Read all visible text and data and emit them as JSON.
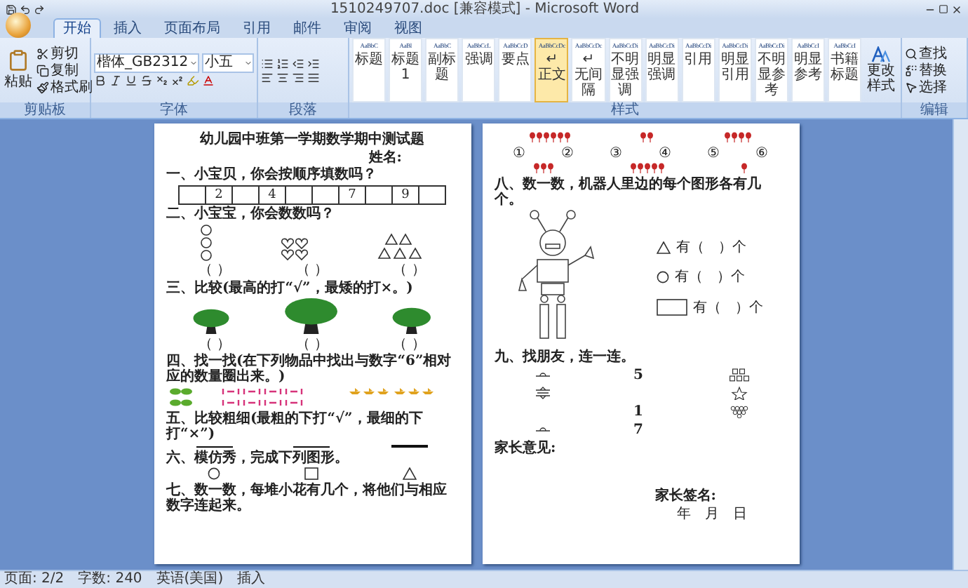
{
  "window": {
    "title": "1510249707.doc [兼容模式] - Microsoft Word"
  },
  "tabs": [
    {
      "label": "开始",
      "selected": true
    },
    {
      "label": "插入",
      "selected": false
    },
    {
      "label": "页面布局",
      "selected": false
    },
    {
      "label": "引用",
      "selected": false
    },
    {
      "label": "邮件",
      "selected": false
    },
    {
      "label": "审阅",
      "selected": false
    },
    {
      "label": "视图",
      "selected": false
    }
  ],
  "ribbon": {
    "clipboard": {
      "paste": "粘贴",
      "items": [
        "剪切",
        "复制",
        "格式刷"
      ],
      "label": "剪贴板"
    },
    "font": {
      "name": "楷体_GB2312",
      "size": "小五",
      "label": "字体"
    },
    "paragraph": {
      "label": "段落"
    },
    "styles": {
      "items": [
        {
          "sample": "AaBbC",
          "label": "标题",
          "selected": false
        },
        {
          "sample": "AaBl",
          "label": "标题1",
          "selected": false
        },
        {
          "sample": "AaBbC",
          "label": "副标题",
          "selected": false
        },
        {
          "sample": "AaBbCcL",
          "label": "强调",
          "selected": false
        },
        {
          "sample": "AaBbCcD",
          "label": "要点",
          "selected": false
        },
        {
          "sample": "AaBbCcDc",
          "label": "↵ 正文",
          "selected": true
        },
        {
          "sample": "AaBbCcDc",
          "label": "↵ 无间隔",
          "selected": false
        },
        {
          "sample": "AaBbCcDi",
          "label": "不明显强调",
          "selected": false
        },
        {
          "sample": "AaBbCcDi",
          "label": "明显强调",
          "selected": false
        },
        {
          "sample": "AaBbCcDi",
          "label": "引用",
          "selected": false
        },
        {
          "sample": "AaBbCcDi",
          "label": "明显引用",
          "selected": false
        },
        {
          "sample": "AaBbCcDi",
          "label": "不明显参考",
          "selected": false
        },
        {
          "sample": "AaBbCcI",
          "label": "明显参考",
          "selected": false
        },
        {
          "sample": "AaBbCcI",
          "label": "书籍标题",
          "selected": false
        }
      ],
      "change": "更改样式",
      "label": "样式"
    },
    "editing": {
      "items": [
        "查找",
        "替换",
        "选择"
      ],
      "label": "编辑"
    }
  },
  "page_1": {
    "title": "幼儿园中班第一学期数学期中测试题",
    "name_label": "姓名:",
    "q1": {
      "text": "一、小宝贝，你会按顺序填数吗？",
      "cells": [
        null,
        "2",
        null,
        "4",
        null,
        null,
        "7",
        null,
        "9",
        null
      ]
    },
    "q2": {
      "text": "二、小宝宝，你会数数吗？",
      "groups": [
        {
          "kind": "circles",
          "answer": "（ ）"
        },
        {
          "kind": "hearts",
          "answer": "（ ）"
        },
        {
          "kind": "triangles",
          "answer": "（ ）"
        }
      ]
    },
    "q3": {
      "text": "三、比较(最高的打“√”，最矮的打×。)",
      "trees": [
        {
          "kind": "short",
          "answer": "（ ）"
        },
        {
          "kind": "tall",
          "answer": "（ ）"
        },
        {
          "kind": "medium",
          "answer": "（ ）"
        }
      ]
    },
    "q4": {
      "text": "四、找一找(在下列物品中找出与数字“6”相对应的数量圈出来。)"
    },
    "q5": {
      "text": "五、比较粗细(最粗的下打“√”，最细的下打“×”)",
      "lines": [
        {
          "kind": "thin"
        },
        {
          "kind": "medium"
        },
        {
          "kind": "thick"
        }
      ]
    },
    "q6": {
      "text": "六、模仿秀，完成下列图形。",
      "shapes": [
        {
          "kind": "circle"
        },
        {
          "kind": "square"
        },
        {
          "kind": "triangle"
        }
      ]
    },
    "q7": {
      "text": "七、数一数，每堆小花有几个，将他们与相应数字连起来。"
    }
  },
  "page_2": {
    "numbers": [
      "①",
      "②",
      "③",
      "④",
      "⑤",
      "⑥"
    ],
    "q8": {
      "text": "八、数一数，机器人里边的每个图形各有几个。",
      "counts": [
        {
          "kind": "triangle",
          "text": "有（　）个"
        },
        {
          "kind": "circle",
          "text": "有（　）个"
        },
        {
          "kind": "rectangle",
          "text": "有（　）个"
        }
      ]
    },
    "q9": {
      "text": "九、找朋友，连一连。",
      "rows": [
        {
          "left": {
            "kind": "dish"
          },
          "number": "5",
          "right": {
            "kind": "squares"
          }
        },
        {
          "left": {
            "kind": "stack"
          },
          "right": {
            "kind": "star"
          }
        },
        {
          "number": "1",
          "right": {
            "kind": "grapes"
          }
        },
        {
          "left": {
            "kind": "dish"
          },
          "number": "7"
        }
      ]
    },
    "parent_comment": "家长意见:",
    "parent_signature": "家长签名:",
    "date": "年　月　日"
  },
  "status_bar": [
    "页面: 2/2",
    "字数: 240",
    "英语(美国)",
    "插入"
  ]
}
